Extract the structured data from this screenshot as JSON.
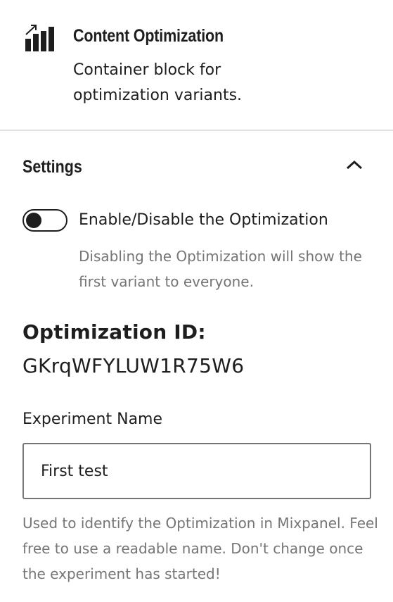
{
  "block": {
    "icon": "chart-bars-trend-icon",
    "title": "Content Optimization",
    "description": "Container block for optimization variants."
  },
  "settings_panel": {
    "title": "Settings",
    "expanded": true,
    "chevron_icon": "chevron-up-icon",
    "toggle": {
      "label": "Enable/Disable the Optimization",
      "checked": false,
      "help": "Disabling the Optimization will show the first variant to everyone."
    },
    "optimization_id": {
      "label": "Optimization ID:",
      "value": "GKrqWFYLUW1R75W6"
    },
    "experiment_name": {
      "label": "Experiment Name",
      "value": "First test",
      "help": "Used to identify the Optimization in Mixpanel. Feel free to use a readable name. Don't change once the experiment has started!"
    }
  },
  "colors": {
    "text": "#1e1e1e",
    "muted": "#757575",
    "divider": "#e0e0e0",
    "input_border": "#757575"
  }
}
